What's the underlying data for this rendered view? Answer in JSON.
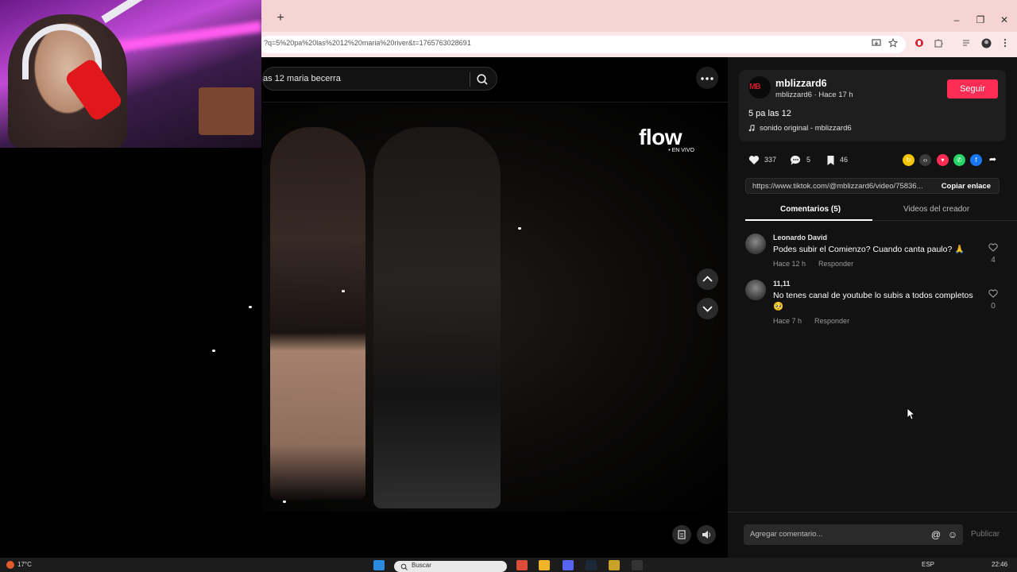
{
  "browser": {
    "url": "?q=5%20pa%20las%2012%20maria%20river&t=1765763028691",
    "new_tab_symbol": "+",
    "tab_edge_symbol": "‹",
    "window_controls": [
      "–",
      "❐",
      "✕"
    ]
  },
  "search": {
    "query": "as 12 maria becerra"
  },
  "video": {
    "overlay_logo": "flow",
    "overlay_logo_sub": "• EN VIVO"
  },
  "post": {
    "username": "mblizzard6",
    "handle": "mblizzard6",
    "time_ago": "Hace 17 h",
    "follow_label": "Seguir",
    "caption": "5 pa las 12",
    "sound": "sonido original - mblizzard6",
    "avatar_text": "MB",
    "likes": "337",
    "comments": "5",
    "saves": "46",
    "link": "https://www.tiktok.com/@mblizzard6/video/75836...",
    "copy_label": "Copiar enlace"
  },
  "tabs": {
    "comments": "Comentarios (5)",
    "creator_videos": "Videos del creador"
  },
  "comments": [
    {
      "name": "Leonardo David",
      "text": "Podes subir el Comienzo? Cuando canta paulo? 🙏",
      "time": "Hace 12 h",
      "reply": "Responder",
      "likes": "4"
    },
    {
      "name": "11,11",
      "text": "No tenes canal de youtube lo subis a todos completos 🥺",
      "time": "Hace 7 h",
      "reply": "Responder",
      "likes": "0"
    }
  ],
  "composer": {
    "placeholder": "Agregar comentario...",
    "at_symbol": "@",
    "emoji_symbol": "☺",
    "publish_label": "Publicar"
  },
  "taskbar": {
    "weather": "17°C",
    "search_label": "Buscar",
    "language": "ESP",
    "time": "22:46"
  },
  "colors": {
    "accent": "#fe2c55",
    "panel_bg": "#121212",
    "tab_bar": "#f7d4d4"
  }
}
